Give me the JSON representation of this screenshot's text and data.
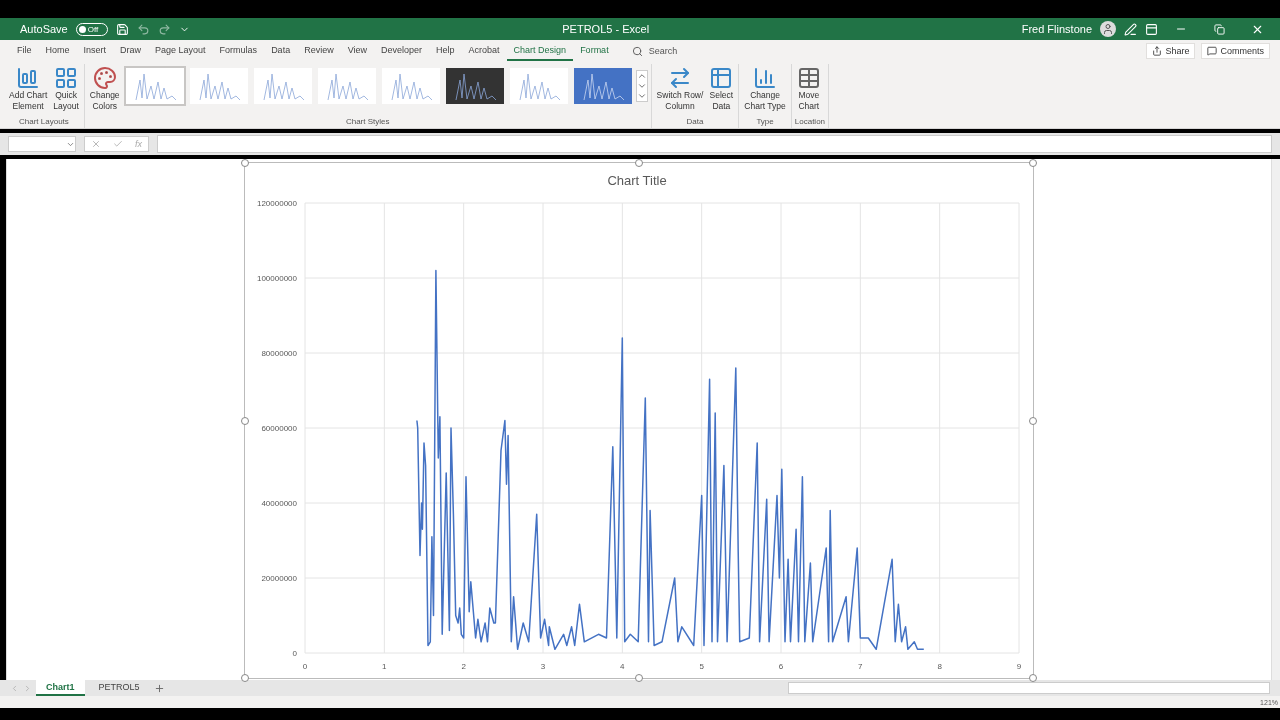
{
  "title_bar": {
    "autosave_label": "AutoSave",
    "autosave": {
      "on": false,
      "label": "Off"
    },
    "title": "PETROL5  -  Excel",
    "user": "Fred Flinstone"
  },
  "ribbon_tabs": [
    {
      "label": "File",
      "selected": false
    },
    {
      "label": "Home",
      "selected": false
    },
    {
      "label": "Insert",
      "selected": false
    },
    {
      "label": "Draw",
      "selected": false
    },
    {
      "label": "Page Layout",
      "selected": false
    },
    {
      "label": "Formulas",
      "selected": false
    },
    {
      "label": "Data",
      "selected": false
    },
    {
      "label": "Review",
      "selected": false
    },
    {
      "label": "View",
      "selected": false
    },
    {
      "label": "Developer",
      "selected": false
    },
    {
      "label": "Help",
      "selected": false
    },
    {
      "label": "Acrobat",
      "selected": false
    },
    {
      "label": "Chart Design",
      "selected": true
    },
    {
      "label": "Format",
      "selected": false,
      "contextual": true
    }
  ],
  "search": {
    "placeholder": "Search"
  },
  "share_button": "Share",
  "comments_button": "Comments",
  "ribbon": {
    "chart_layouts": {
      "label": "Chart Layouts",
      "buttons": [
        [
          "Add Chart",
          "Element"
        ],
        [
          "Quick",
          "Layout"
        ]
      ]
    },
    "chart_styles": {
      "label": "Chart Styles",
      "change_colors": [
        "Change",
        "Colors"
      ],
      "styles": [
        {
          "kind": "light",
          "selected": true
        },
        {
          "kind": "light",
          "selected": false
        },
        {
          "kind": "light",
          "selected": false
        },
        {
          "kind": "light",
          "selected": false
        },
        {
          "kind": "light",
          "selected": false
        },
        {
          "kind": "dark",
          "selected": false
        },
        {
          "kind": "light",
          "selected": false
        },
        {
          "kind": "blue",
          "selected": false
        }
      ]
    },
    "data": {
      "label": "Data",
      "buttons": [
        [
          "Switch Row/",
          "Column"
        ],
        [
          "Select",
          "Data"
        ]
      ]
    },
    "type": {
      "label": "Type",
      "buttons": [
        [
          "Change",
          "Chart Type"
        ]
      ]
    },
    "location": {
      "label": "Location",
      "buttons": [
        [
          "Move",
          "Chart"
        ]
      ]
    }
  },
  "chart": {
    "chart_data": {
      "type": "line",
      "title": "Chart Title",
      "x": [
        1.41,
        1.42,
        1.45,
        1.47,
        1.48,
        1.5,
        1.52,
        1.55,
        1.58,
        1.6,
        1.62,
        1.65,
        1.68,
        1.7,
        1.73,
        1.78,
        1.82,
        1.84,
        1.87,
        1.9,
        1.93,
        1.95,
        1.97,
        2.0,
        2.03,
        2.07,
        2.09,
        2.15,
        2.18,
        2.22,
        2.27,
        2.3,
        2.33,
        2.38,
        2.4,
        2.47,
        2.52,
        2.54,
        2.56,
        2.6,
        2.63,
        2.68,
        2.75,
        2.82,
        2.92,
        2.97,
        3.02,
        3.07,
        3.08,
        3.15,
        3.26,
        3.3,
        3.36,
        3.4,
        3.46,
        3.52,
        3.7,
        3.8,
        3.88,
        3.93,
        4.0,
        4.03,
        4.1,
        4.2,
        4.29,
        4.33,
        4.35,
        4.4,
        4.5,
        4.66,
        4.7,
        4.75,
        4.9,
        5.0,
        5.03,
        5.1,
        5.13,
        5.17,
        5.2,
        5.28,
        5.32,
        5.43,
        5.46,
        5.48,
        5.6,
        5.7,
        5.73,
        5.82,
        5.85,
        5.95,
        5.98,
        6.01,
        6.05,
        6.09,
        6.12,
        6.19,
        6.22,
        6.27,
        6.3,
        6.37,
        6.4,
        6.57,
        6.6,
        6.62,
        6.65,
        6.82,
        6.85,
        6.96,
        7.0,
        7.1,
        7.2,
        7.4,
        7.44,
        7.48,
        7.52,
        7.57,
        7.6,
        7.68,
        7.72,
        7.8
      ],
      "grid": true,
      "series": [
        {
          "color": "#4472c4",
          "values": [
            62000000,
            60000000,
            26000000,
            40000000,
            33000000,
            56000000,
            50000000,
            2000000,
            3000000,
            31000000,
            10000000,
            102000000,
            52000000,
            63000000,
            5000000,
            48000000,
            6000000,
            60000000,
            37000000,
            10000000,
            8000000,
            12000000,
            5000000,
            4000000,
            47000000,
            11000000,
            19000000,
            4000000,
            9000000,
            3000000,
            8000000,
            3000000,
            12000000,
            8000000,
            8000000,
            54000000,
            62000000,
            45000000,
            58000000,
            3000000,
            15000000,
            1000000,
            8000000,
            3000000,
            37000000,
            4000000,
            9000000,
            2000000,
            7000000,
            1000000,
            5000000,
            2000000,
            7000000,
            2000000,
            13000000,
            3000000,
            5000000,
            4000000,
            55000000,
            4000000,
            84000000,
            3000000,
            5000000,
            3000000,
            68000000,
            3000000,
            38000000,
            2000000,
            3000000,
            20000000,
            3000000,
            7000000,
            2000000,
            42000000,
            2000000,
            73000000,
            3000000,
            64000000,
            3000000,
            50000000,
            3000000,
            76000000,
            27000000,
            3000000,
            4000000,
            56000000,
            3000000,
            41000000,
            3000000,
            42000000,
            20000000,
            49000000,
            3000000,
            25000000,
            3000000,
            33000000,
            3000000,
            47000000,
            3000000,
            24000000,
            3000000,
            28000000,
            3000000,
            38000000,
            3000000,
            15000000,
            3000000,
            28000000,
            4000000,
            4000000,
            1000000,
            25000000,
            3000000,
            13000000,
            3000000,
            7000000,
            1000000,
            3000000,
            1000000,
            1000000
          ]
        }
      ],
      "xlim": [
        0,
        9
      ],
      "ylim": [
        0,
        120000000
      ],
      "xticks": [
        0,
        1,
        2,
        3,
        4,
        5,
        6,
        7,
        8,
        9
      ],
      "yticks": [
        {
          "value": 0,
          "label": "0"
        },
        {
          "value": 20000000,
          "label": "20000000"
        },
        {
          "value": 40000000,
          "label": "40000000"
        },
        {
          "value": 60000000,
          "label": "60000000"
        },
        {
          "value": 80000000,
          "label": "80000000"
        },
        {
          "value": 100000000,
          "label": "100000000"
        },
        {
          "value": 120000000,
          "label": "120000000"
        }
      ]
    }
  },
  "formula_bar": {
    "fx": "fx"
  },
  "sheet_tabs": [
    {
      "label": "Chart1",
      "selected": true
    },
    {
      "label": "PETROL5",
      "selected": false
    }
  ],
  "status_bar": {
    "zoom": "121%"
  }
}
